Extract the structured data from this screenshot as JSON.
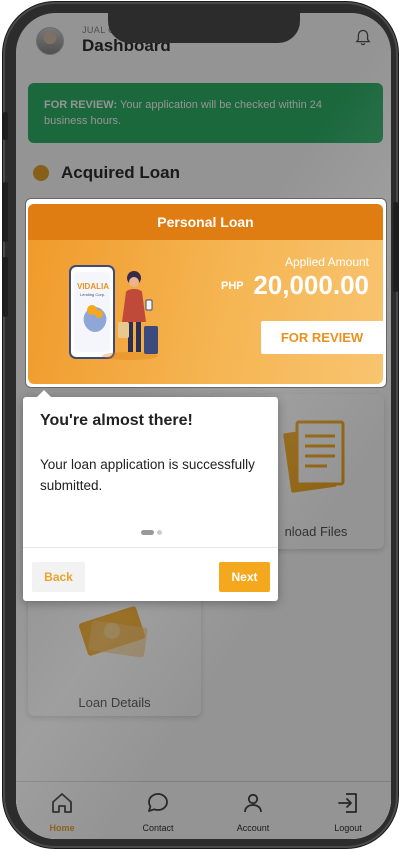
{
  "header": {
    "user_name": "JUAL CRUZ",
    "page_title": "Dashboard"
  },
  "banner": {
    "status_prefix": "FOR REVIEW:",
    "message": " Your application will be checked within 24 business hours."
  },
  "section": {
    "title": "Acquired Loan"
  },
  "loan_card": {
    "title": "Personal Loan",
    "amount_label": "Applied Amount",
    "currency": "PHP",
    "amount": "20,000.00",
    "status_button": "FOR REVIEW",
    "brand_text": "VIDALIA",
    "brand_subtext": "Lending Corp."
  },
  "tiles": {
    "downloads_label": "nload Files",
    "loan_details_label": "Loan Details"
  },
  "popup": {
    "title": "You're almost there!",
    "body": "Your loan application is successfully submitted.",
    "back_label": "Back",
    "next_label": "Next",
    "page_index": 1,
    "page_count": 2
  },
  "bottom_nav": {
    "items": [
      {
        "label": "Home",
        "icon": "home-icon",
        "active": true
      },
      {
        "label": "Contact",
        "icon": "chat-icon",
        "active": false
      },
      {
        "label": "Account",
        "icon": "user-icon",
        "active": false
      },
      {
        "label": "Logout",
        "icon": "logout-icon",
        "active": false
      }
    ]
  },
  "colors": {
    "accent": "#e8a42a",
    "banner_green": "#2fb36a",
    "card_orange": "#f09a2a",
    "next_button": "#f4a81d"
  }
}
